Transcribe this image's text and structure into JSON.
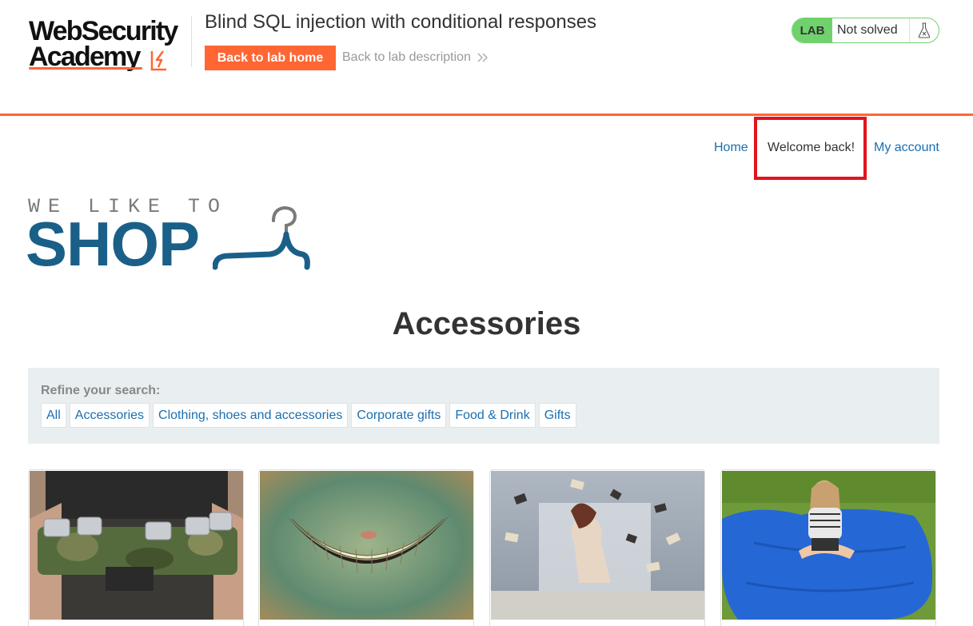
{
  "academy": {
    "logo_line1": "WebSecurity",
    "logo_line2": "Academy",
    "lab_title": "Blind SQL injection with conditional responses",
    "back_home_label": "Back to lab home",
    "back_description_label": "Back to lab description",
    "lab_badge": "LAB",
    "lab_status": "Not solved",
    "brand_orange": "#ff6633",
    "status_green": "#70d16d"
  },
  "nav": {
    "home": "Home",
    "welcome": "Welcome back!",
    "my_account": "My account",
    "link_color": "#1b6fb0"
  },
  "shop_logo": {
    "tagline": "WE LIKE TO",
    "name": "SHOP",
    "icon": "hanger-icon",
    "color": "#1a5f88"
  },
  "page": {
    "heading": "Accessories"
  },
  "filters": {
    "label": "Refine your search:",
    "categories": [
      "All",
      "Accessories",
      "Clothing, shoes and accessories",
      "Corporate gifts",
      "Food & Drink",
      "Gifts"
    ]
  },
  "products": [
    {
      "image": "camouflage beer can belt"
    },
    {
      "image": "cheshire cat grin"
    },
    {
      "image": "woman with floating books"
    },
    {
      "image": "girl on giant blue bean bag"
    }
  ],
  "annotation": {
    "highlight_color": "#e3131c"
  }
}
